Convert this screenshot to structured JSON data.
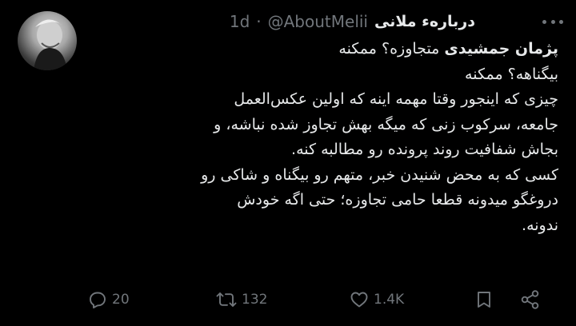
{
  "tweet": {
    "display_name": "درباره‌ء ملانی",
    "handle": "@AboutMelii",
    "separator": "·",
    "time": "1d",
    "mention": "پژمان جمشیدی",
    "lines": [
      "متجاوزه؟ ممکنه",
      "بیگناهه؟ ممکنه",
      "چیزی که اینجور وقتا مهمه اینه که اولین عکس‌العمل",
      "جامعه، سرکوب زنی که میگه بهش تجاوز شده نباشه، و",
      "بجاش شفافیت روند پرونده رو مطالبه کنه.",
      "کسی که به محض شنیدن خبر، متهم رو بیگناه و شاکی رو",
      "دروغگو میدونه قطعا حامی تجاوزه؛ حتی اگه خودش",
      "ندونه."
    ]
  },
  "actions": {
    "replies": "20",
    "retweets": "132",
    "likes": "1.4K"
  },
  "icons": {
    "reply": "reply-icon",
    "retweet": "retweet-icon",
    "like": "heart-icon",
    "bookmark": "bookmark-icon",
    "share": "share-icon",
    "more": "more-icon"
  },
  "colors": {
    "background": "#000000",
    "primary_text": "#e7e9ea",
    "secondary_text": "#71767b"
  }
}
